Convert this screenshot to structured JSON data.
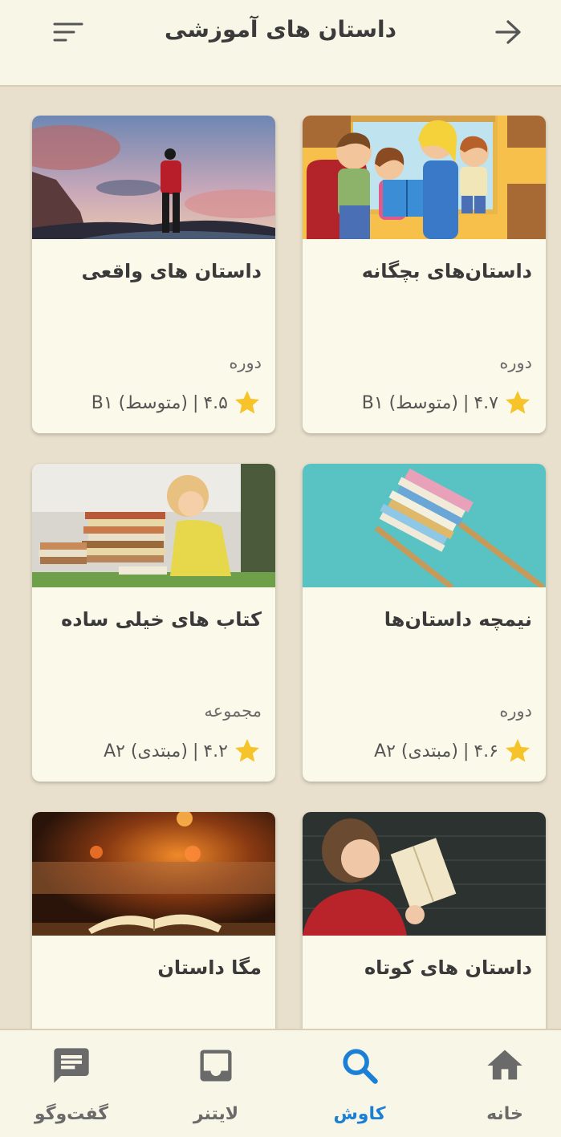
{
  "header": {
    "title": "داستان های آموزشی",
    "back_icon": "arrow-right-icon",
    "filter_icon": "filter-sort-icon"
  },
  "colors": {
    "background": "#e8e0cc",
    "surface": "#fbf9e9",
    "star": "#f6c42a",
    "active_nav": "#1b7fd6",
    "inactive_nav": "#6a6a6a"
  },
  "cards": [
    {
      "title": "داستان‌های بچگانه",
      "type": "دوره",
      "rating": "۴.۷",
      "level": "(متوسط) B۱",
      "image": "family-reading-illustration"
    },
    {
      "title": "داستان های واقعی",
      "type": "دوره",
      "rating": "۴.۵",
      "level": "(متوسط) B۱",
      "image": "man-on-mountain-sunset"
    },
    {
      "title": "نیمچه داستان‌ها",
      "type": "دوره",
      "rating": "۴.۶",
      "level": "(مبتدی) A۲",
      "image": "book-stack-on-sticks"
    },
    {
      "title": "کتاب های خیلی ساده",
      "type": "مجموعه",
      "rating": "۴.۲",
      "level": "(مبتدی) A۲",
      "image": "girl-with-books"
    },
    {
      "title": "داستان های کوتاه",
      "type": "",
      "rating": "",
      "level": "",
      "image": "woman-reading-book"
    },
    {
      "title": "مگا داستان",
      "type": "",
      "rating": "",
      "level": "",
      "image": "open-book-fireplace"
    }
  ],
  "nav": {
    "home": {
      "label": "خانه",
      "icon": "home-icon"
    },
    "explore": {
      "label": "کاوش",
      "icon": "search-icon"
    },
    "leitner": {
      "label": "لایتنر",
      "icon": "inbox-icon"
    },
    "chat": {
      "label": "گفت‌وگو",
      "icon": "chat-icon"
    }
  }
}
